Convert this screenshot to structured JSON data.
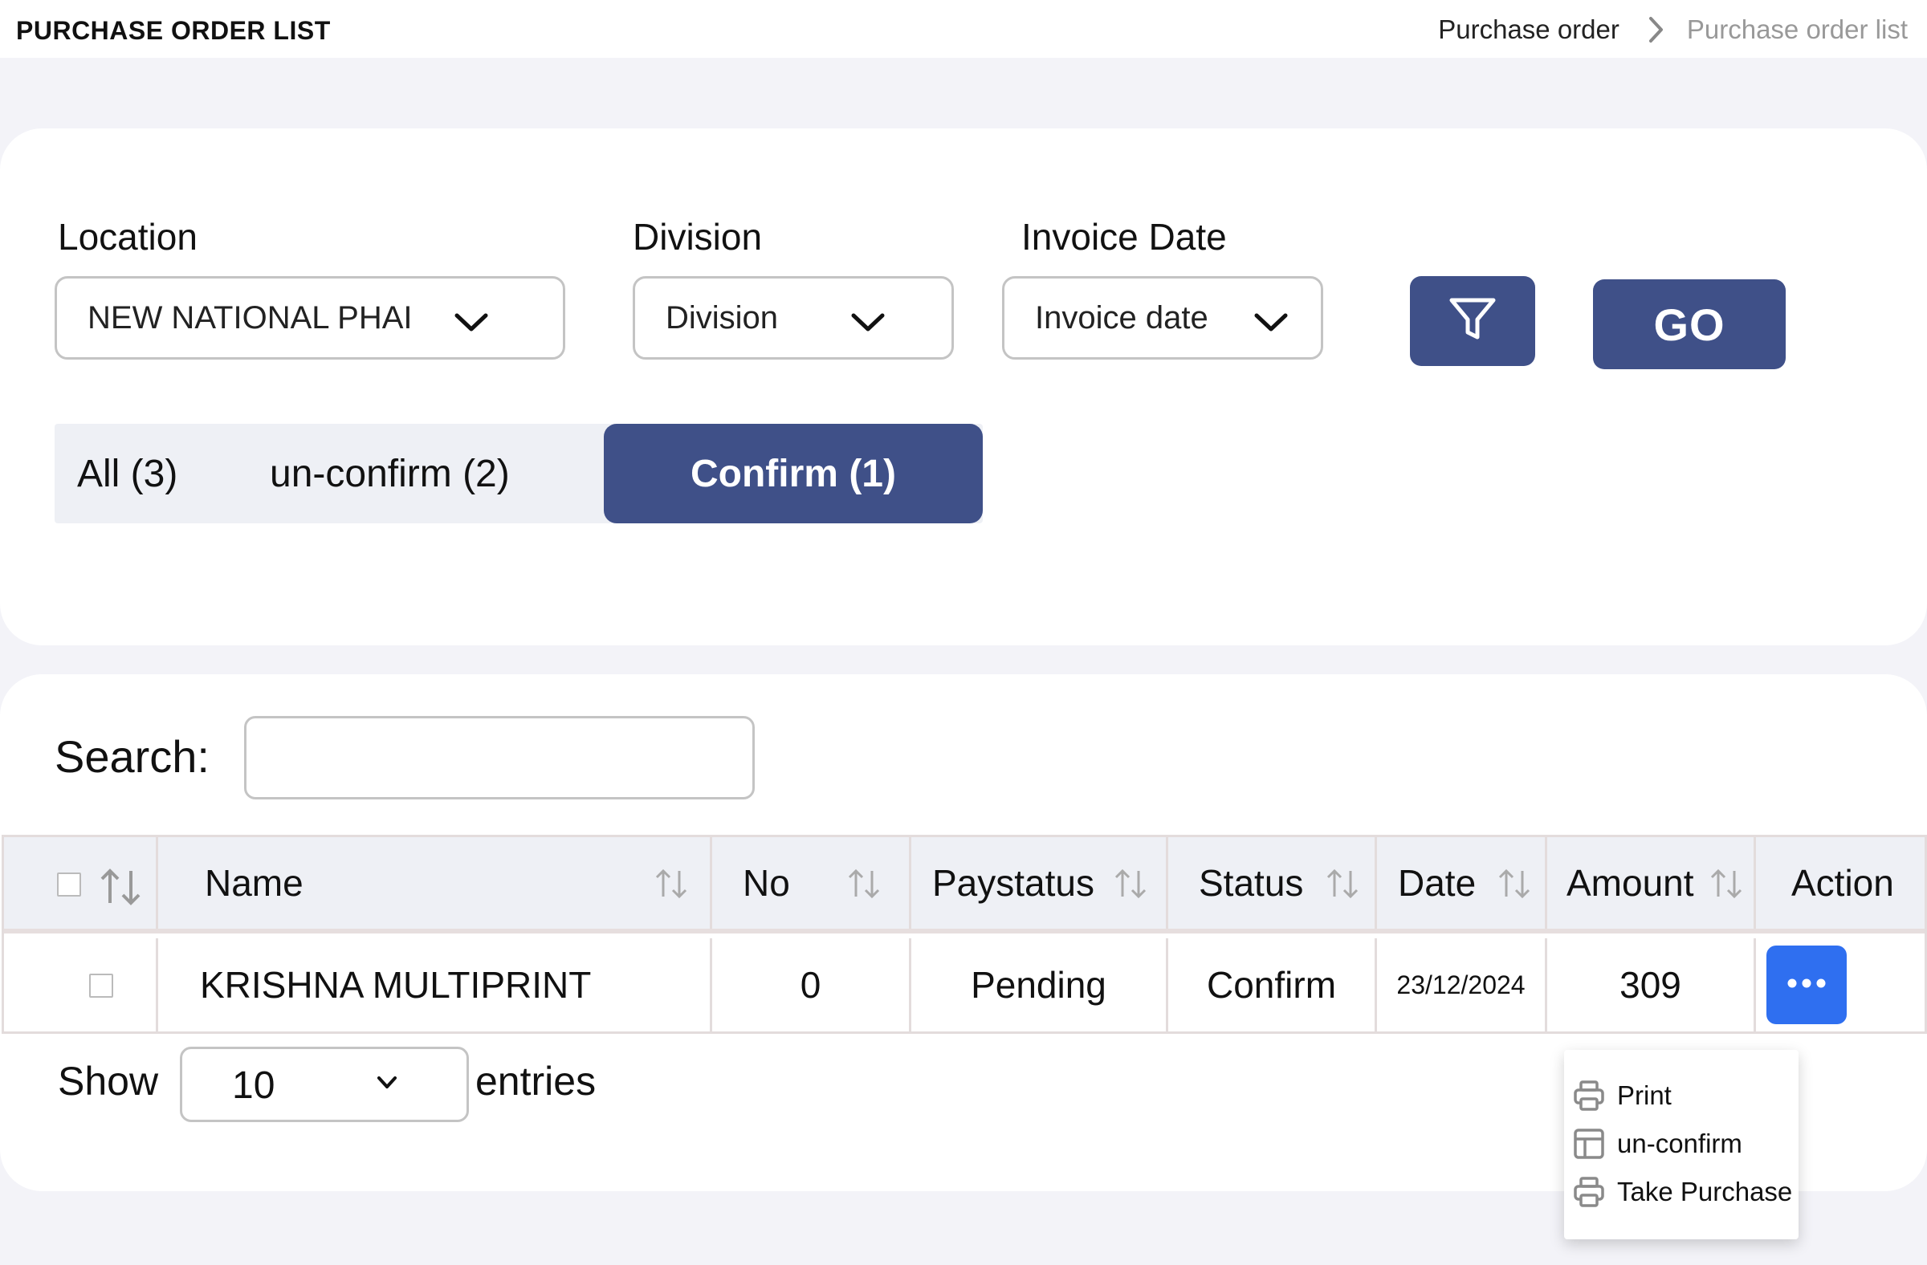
{
  "header": {
    "title": "PURCHASE ORDER LIST",
    "breadcrumb": [
      "Purchase order",
      "Purchase order list"
    ]
  },
  "filters": {
    "location": {
      "label": "Location",
      "value": "NEW NATIONAL PHAI"
    },
    "division": {
      "label": "Division",
      "value": "Division"
    },
    "invoice_date": {
      "label": "Invoice Date",
      "value": "Invoice date"
    },
    "go_label": "GO"
  },
  "tabs": [
    {
      "label": "All (3)",
      "active": false
    },
    {
      "label": "un-confirm (2)",
      "active": false
    },
    {
      "label": "Confirm (1)",
      "active": true
    }
  ],
  "search": {
    "label": "Search:",
    "value": ""
  },
  "table": {
    "columns": [
      "Name",
      "No",
      "Paystatus",
      "Status",
      "Date",
      "Amount",
      "Action"
    ],
    "rows": [
      {
        "name": "KRISHNA MULTIPRINT",
        "no": "0",
        "paystatus": "Pending",
        "status": "Confirm",
        "date": "23/12/2024",
        "amount": "309"
      }
    ]
  },
  "pagination": {
    "show_label": "Show",
    "page_size": "10",
    "entries_label": "entries"
  },
  "action_menu": {
    "items": [
      {
        "label": "Print",
        "icon": "printer-icon"
      },
      {
        "label": "un-confirm",
        "icon": "layout-icon"
      },
      {
        "label": "Take Purchase",
        "icon": "printer-icon"
      }
    ]
  },
  "colors": {
    "primary": "#3f5088",
    "action": "#2f6ff0",
    "background": "#f3f3f8"
  }
}
